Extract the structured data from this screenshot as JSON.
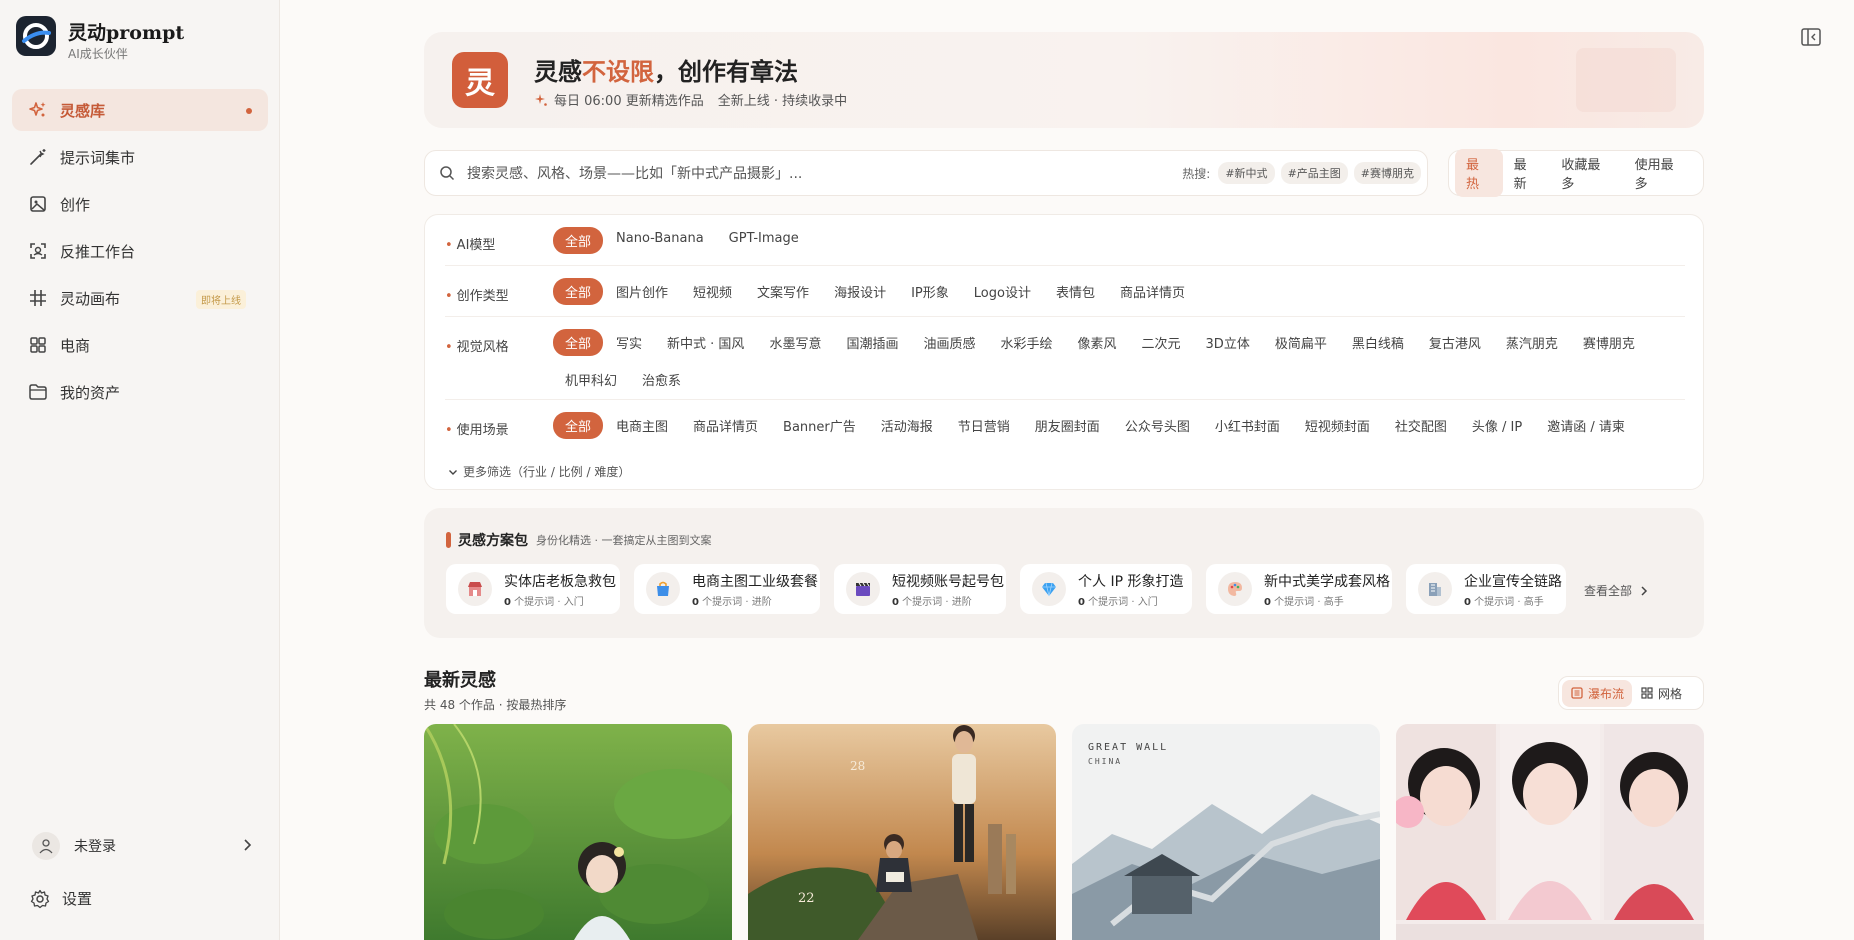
{
  "app": {
    "name": "灵动prompt",
    "tagline": "AI成长伙伴"
  },
  "nav": [
    {
      "label": "灵感库",
      "icon": "sparkles-icon",
      "active": true
    },
    {
      "label": "提示词集市",
      "icon": "magic-wand-icon"
    },
    {
      "label": "创作",
      "icon": "image-icon"
    },
    {
      "label": "反推工作台",
      "icon": "scan-icon"
    },
    {
      "label": "灵动画布",
      "icon": "hash-icon",
      "badge": "即将上线"
    },
    {
      "label": "电商",
      "icon": "grid-icon"
    },
    {
      "label": "我的资产",
      "icon": "folder-icon"
    }
  ],
  "user": {
    "label": "未登录"
  },
  "settings": {
    "label": "设置"
  },
  "banner": {
    "logo_char": "灵",
    "title_pre": "灵感",
    "title_highlight": "不设限",
    "title_post": "，创作有章法",
    "update_text": "每日 06:00 更新精选作品",
    "status_text": "全新上线 · 持续收录中"
  },
  "search": {
    "placeholder": "搜索灵感、风格、场景——比如「新中式产品摄影」...",
    "hot_label": "热搜:",
    "hot_tags": [
      "#新中式",
      "#产品主图",
      "#赛博朋克"
    ]
  },
  "sort": {
    "options": [
      "最热",
      "最新",
      "收藏最多",
      "使用最多"
    ],
    "active": "最热"
  },
  "filters": {
    "model": {
      "label": "AI模型",
      "options": [
        "全部",
        "Nano-Banana",
        "GPT-Image"
      ]
    },
    "type": {
      "label": "创作类型",
      "options": [
        "全部",
        "图片创作",
        "短视频",
        "文案写作",
        "海报设计",
        "IP形象",
        "Logo设计",
        "表情包",
        "商品详情页"
      ]
    },
    "style": {
      "label": "视觉风格",
      "options": [
        "全部",
        "写实",
        "新中式 · 国风",
        "水墨写意",
        "国潮插画",
        "油画质感",
        "水彩手绘",
        "像素风",
        "二次元",
        "3D立体",
        "极简扁平",
        "黑白线稿",
        "复古港风",
        "蒸汽朋克",
        "赛博朋克",
        "机甲科幻",
        "治愈系"
      ]
    },
    "scene": {
      "label": "使用场景",
      "options": [
        "全部",
        "电商主图",
        "商品详情页",
        "Banner广告",
        "活动海报",
        "节日营销",
        "朋友圈封面",
        "公众号头图",
        "小红书封面",
        "短视频封面",
        "社交配图",
        "头像 / IP",
        "邀请函 / 请柬"
      ]
    },
    "more": "更多筛选（行业 / 比例 / 难度）"
  },
  "packs": {
    "title": "灵感方案包",
    "subtitle": "身份化精选 · 一套搞定从主图到文案",
    "items": [
      {
        "name": "实体店老板急救包",
        "count": "0",
        "meta": "个提示词 · 入门",
        "icon": "store-icon"
      },
      {
        "name": "电商主图工业级套餐",
        "count": "0",
        "meta": "个提示词 · 进阶",
        "icon": "shopping-bag-icon"
      },
      {
        "name": "短视频账号起号包",
        "count": "0",
        "meta": "个提示词 · 进阶",
        "icon": "clapperboard-icon"
      },
      {
        "name": "个人 IP 形象打造",
        "count": "0",
        "meta": "个提示词 · 入门",
        "icon": "diamond-icon"
      },
      {
        "name": "新中式美学成套风格",
        "count": "0",
        "meta": "个提示词 · 高手",
        "icon": "palette-icon"
      },
      {
        "name": "企业宣传全链路",
        "count": "0",
        "meta": "个提示词 · 高手",
        "icon": "building-icon"
      }
    ],
    "view_all": "查看全部"
  },
  "latest": {
    "title": "最新灵感",
    "subtitle": "共 48 个作品 · 按最热排序",
    "views": [
      "瀑布流",
      "网格"
    ],
    "active_view": "瀑布流",
    "cards": [
      {
        "alt": "lotus-pond-girl-thumbnail",
        "texts": []
      },
      {
        "alt": "reading-man-sunset-thumbnail",
        "texts": [
          "28",
          "22"
        ]
      },
      {
        "alt": "great-wall-thumbnail",
        "texts": [
          "GREAT WALL",
          "CHINA"
        ]
      },
      {
        "alt": "portrait-collage-thumbnail",
        "texts": []
      }
    ]
  },
  "colors": {
    "accent": "#d2643e",
    "sidebar_bg": "#f7f5f3",
    "page_bg": "#fcfaf8"
  }
}
